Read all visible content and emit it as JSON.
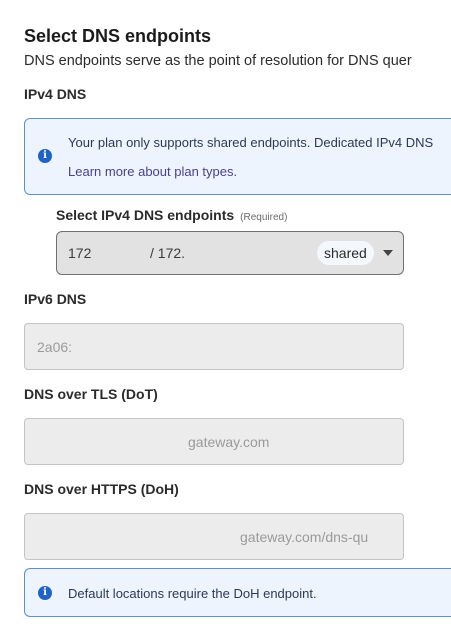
{
  "header": {
    "title": "Select DNS endpoints",
    "description": "DNS endpoints serve as the point of resolution for DNS quer"
  },
  "ipv4": {
    "label": "IPv4 DNS",
    "info": {
      "text": "Your plan only supports shared endpoints. Dedicated IPv4 DNS",
      "link": "Learn more about plan types."
    },
    "select": {
      "label": "Select IPv4 DNS endpoints",
      "required": "(Required)",
      "value_primary": "172",
      "value_secondary": "/ 172.",
      "chip": "shared"
    }
  },
  "ipv6": {
    "label": "IPv6 DNS",
    "value": "2a06:"
  },
  "dot": {
    "label": "DNS over TLS (DoT)",
    "value": "gateway.com"
  },
  "doh": {
    "label": "DNS over HTTPS (DoH)",
    "value": "gateway.com/dns-qu"
  },
  "footer_info": {
    "text": "Default locations require the DoH endpoint."
  },
  "colors": {
    "info_background": "#eef4fd",
    "info_border": "#5c8fd6",
    "info_icon": "#1f63c6",
    "link": "#4a3f8c",
    "readonly_field": "#ececec"
  },
  "icons": {
    "info": "info-circle-icon",
    "dropdown": "caret-down-icon"
  }
}
